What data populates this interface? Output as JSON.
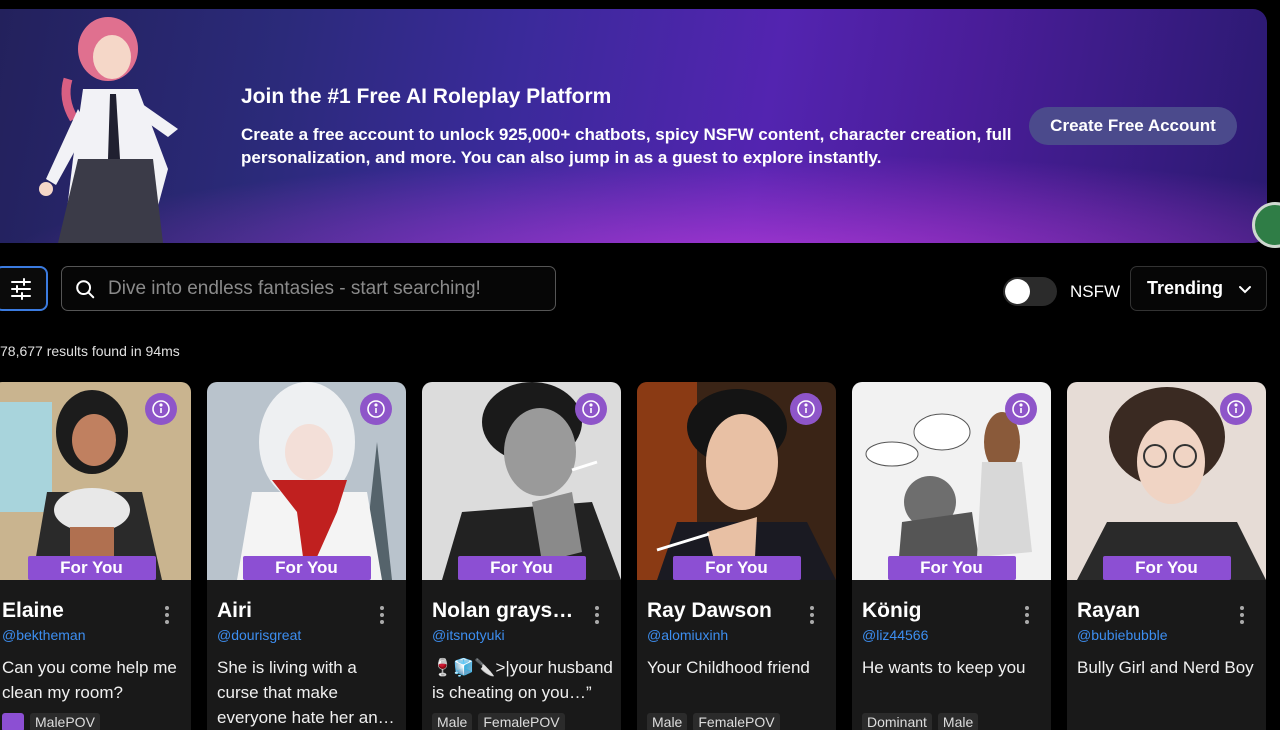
{
  "banner": {
    "title": "Join the #1 Free AI Roleplay Platform",
    "description": "Create a free account to unlock 925,000+ chatbots, spicy NSFW content, character creation, full personalization, and more. You can also jump in as a guest to explore instantly.",
    "cta_label": "Create Free Account"
  },
  "search": {
    "placeholder": "Dive into endless fantasies - start searching!"
  },
  "filters": {
    "nsfw_label": "NSFW",
    "nsfw_enabled": false,
    "sort_value": "Trending"
  },
  "results_text": "78,677 results found in 94ms",
  "badge_label": "For You",
  "cards": [
    {
      "name": "Elaine",
      "handle": "@bektheman",
      "description": "Can you come help me clean my room?",
      "tags": [
        "MalePOV"
      ],
      "has_tag_icon": true
    },
    {
      "name": "Airi",
      "handle": "@dourisgreat",
      "description": "She is living with a curse that make everyone hate her an…",
      "tags": []
    },
    {
      "name": "Nolan grays…",
      "handle": "@itsnotyuki",
      "description": "🍷🧊🔪>|your husband is cheating on you…”",
      "tags": [
        "Male",
        "FemalePOV"
      ]
    },
    {
      "name": "Ray Dawson",
      "handle": "@alomiuxinh",
      "description": "Your Childhood friend",
      "tags": [
        "Male",
        "FemalePOV"
      ]
    },
    {
      "name": "König",
      "handle": "@liz44566",
      "description": "He wants to keep you",
      "tags": [
        "Dominant",
        "Male"
      ]
    },
    {
      "name": "Rayan",
      "handle": "@bubiebubble",
      "description": "Bully Girl and Nerd Boy",
      "tags": []
    }
  ],
  "colors": {
    "accent_purple": "#8c4fd3",
    "link_blue": "#3d8ef0",
    "focus_blue": "#3b7be0"
  }
}
